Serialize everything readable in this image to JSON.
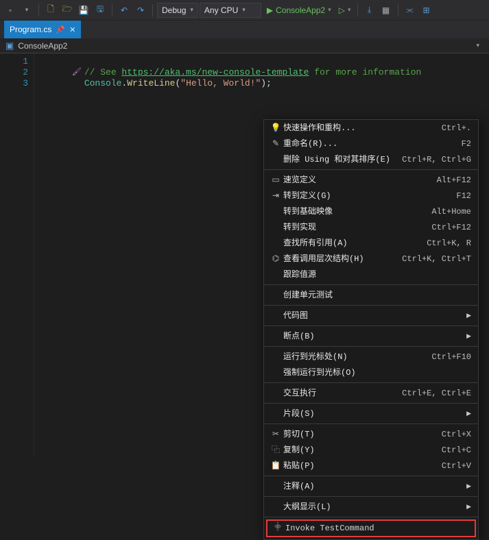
{
  "toolbar": {
    "config": "Debug",
    "platform": "Any CPU",
    "run_target": "ConsoleApp2"
  },
  "tab": {
    "filename": "Program.cs"
  },
  "navbar": {
    "project": "ConsoleApp2"
  },
  "code": {
    "line1_comment_prefix": "// See ",
    "line1_url": "https://aka.ms/new-console-template",
    "line1_comment_suffix": " for more information",
    "line2_type": "Console",
    "line2_dot": ".",
    "line2_method": "WriteLine",
    "line2_paren_open": "(",
    "line2_string": "\"Hello, World!\"",
    "line2_paren_close_semi": ");"
  },
  "menu": [
    {
      "icon": "💡",
      "label": "快速操作和重构...",
      "shortcut": "Ctrl+."
    },
    {
      "icon": "✎",
      "label": "重命名(R)...",
      "shortcut": "F2"
    },
    {
      "icon": "",
      "label": "删除 Using 和对其排序(E)",
      "shortcut": "Ctrl+R, Ctrl+G"
    },
    {
      "sep": true
    },
    {
      "icon": "▭",
      "label": "速览定义",
      "shortcut": "Alt+F12"
    },
    {
      "icon": "⇥",
      "label": "转到定义(G)",
      "shortcut": "F12"
    },
    {
      "icon": "",
      "label": "转到基础映像",
      "shortcut": "Alt+Home"
    },
    {
      "icon": "",
      "label": "转到实现",
      "shortcut": "Ctrl+F12"
    },
    {
      "icon": "",
      "label": "查找所有引用(A)",
      "shortcut": "Ctrl+K, R"
    },
    {
      "icon": "⌬",
      "label": "查看调用层次结构(H)",
      "shortcut": "Ctrl+K, Ctrl+T"
    },
    {
      "icon": "",
      "label": "跟踪值源",
      "shortcut": ""
    },
    {
      "sep": true
    },
    {
      "icon": "",
      "label": "创建单元测试",
      "shortcut": ""
    },
    {
      "sep": true
    },
    {
      "icon": "",
      "label": "代码图",
      "shortcut": "",
      "submenu": true
    },
    {
      "sep": true
    },
    {
      "icon": "",
      "label": "断点(B)",
      "shortcut": "",
      "submenu": true
    },
    {
      "sep": true
    },
    {
      "icon": "",
      "label": "运行到光标处(N)",
      "shortcut": "Ctrl+F10"
    },
    {
      "icon": "",
      "label": "强制运行到光标(O)",
      "shortcut": ""
    },
    {
      "sep": true
    },
    {
      "icon": "",
      "label": "交互执行",
      "shortcut": "Ctrl+E, Ctrl+E"
    },
    {
      "sep": true
    },
    {
      "icon": "",
      "label": "片段(S)",
      "shortcut": "",
      "submenu": true
    },
    {
      "sep": true
    },
    {
      "icon": "✂",
      "label": "剪切(T)",
      "shortcut": "Ctrl+X"
    },
    {
      "icon": "⿻",
      "label": "复制(Y)",
      "shortcut": "Ctrl+C"
    },
    {
      "icon": "📋",
      "label": "粘贴(P)",
      "shortcut": "Ctrl+V"
    },
    {
      "sep": true
    },
    {
      "icon": "",
      "label": "注释(A)",
      "shortcut": "",
      "submenu": true
    },
    {
      "sep": true
    },
    {
      "icon": "",
      "label": "大纲显示(L)",
      "shortcut": "",
      "submenu": true
    },
    {
      "sep": true
    }
  ],
  "highlight_item": {
    "icon": "⸎",
    "label": "Invoke TestCommand"
  }
}
